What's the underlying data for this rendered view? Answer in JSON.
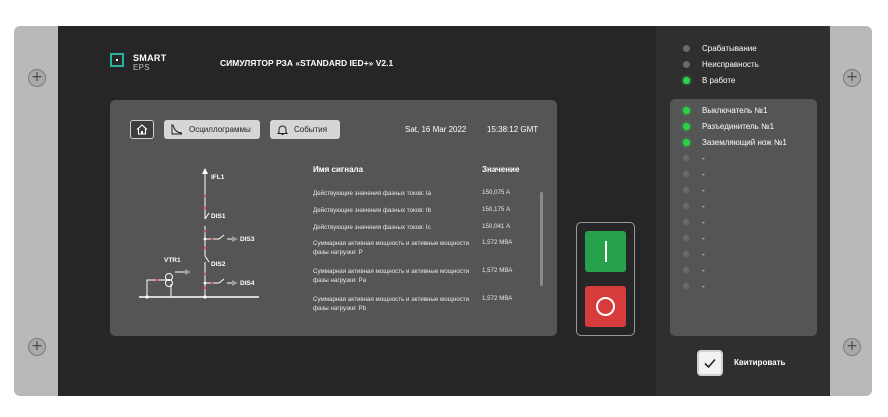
{
  "brand": {
    "line1": "SMART",
    "line2": "EPS"
  },
  "device_title": "СИМУЛЯТОР РЗА «STANDARD IED+» V2.1",
  "toolbar": {
    "home_icon": "home-icon",
    "oscillograms_label": "Осциллограммы",
    "events_label": "События",
    "date": "Sat, 16 Mar 2022",
    "time": "15:38:12 GMT"
  },
  "table": {
    "col_signal": "Имя сигнала",
    "col_value": "Значение",
    "rows": [
      {
        "name": "Действующие значения фазных токов: Ia",
        "value": "150,075 А"
      },
      {
        "name": "Действующие значения фазных токов: Ib",
        "value": "150,175 А"
      },
      {
        "name": "Действующие значения фазных токов: Ic",
        "value": "150,041 А"
      },
      {
        "name": "Суммарная активная мощность и активные мощности фазы нагрузки: P",
        "value": "1,572 МВА"
      },
      {
        "name": "Суммарная активная мощность и активные мощности фазы нагрузки: Pa",
        "value": "1,572 МВА"
      },
      {
        "name": "Суммарная активная мощность и активные мощности фазы нагрузки: Pb",
        "value": "1,572 МВА"
      }
    ]
  },
  "diagram": {
    "labels": {
      "ifl1": "IFL1",
      "dis1": "DIS1",
      "dis3": "DIS3",
      "dis2": "DIS2",
      "dis4": "DIS4",
      "vtr1": "VTR1"
    },
    "colors": {
      "line": "#ffffff",
      "node": "#e05050"
    }
  },
  "controls": {
    "close_button": "close-on-button",
    "open_button": "trip-off-button"
  },
  "status_top": [
    {
      "label": "Срабатывание",
      "on": false
    },
    {
      "label": "Неисправность",
      "on": false
    },
    {
      "label": "В работе",
      "on": true
    }
  ],
  "status_list": [
    {
      "label": "Выключатель №1",
      "on": true
    },
    {
      "label": "Разъединитель №1",
      "on": true
    },
    {
      "label": "Заземляющий нож №1",
      "on": true
    },
    {
      "label": "-",
      "on": false
    },
    {
      "label": "-",
      "on": false
    },
    {
      "label": "-",
      "on": false
    },
    {
      "label": "-",
      "on": false
    },
    {
      "label": "-",
      "on": false
    },
    {
      "label": "-",
      "on": false
    },
    {
      "label": "-",
      "on": false
    },
    {
      "label": "-",
      "on": false
    },
    {
      "label": "-",
      "on": false
    }
  ],
  "acknowledge": {
    "label": "Квитировать",
    "checked": true
  },
  "colors": {
    "led_on": "#2cd14a",
    "led_off": "#6b6b6b",
    "green_button": "#26a24c",
    "red_button": "#d63c3c",
    "logo_accent": "#27b3a6"
  }
}
